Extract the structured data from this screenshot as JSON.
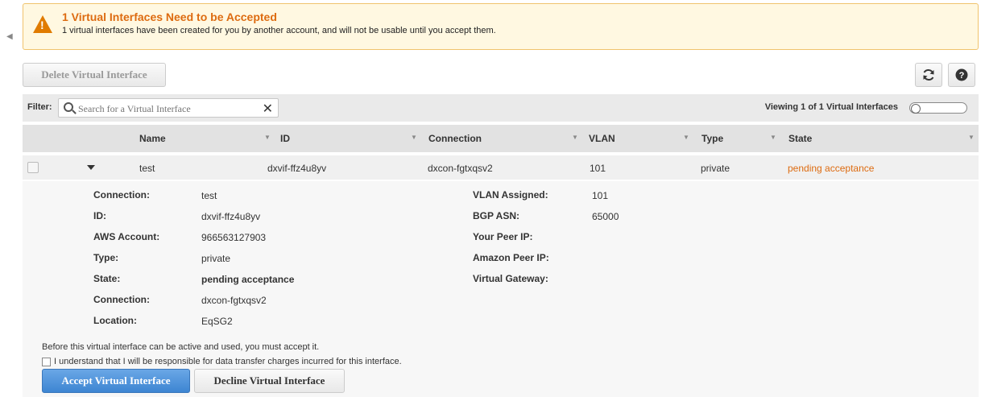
{
  "alert": {
    "title": "1 Virtual Interfaces Need to be Accepted",
    "message": "1 virtual interfaces have been created for you by another account, and will not be usable until you accept them."
  },
  "toolbar": {
    "delete_label": "Delete Virtual Interface"
  },
  "filter": {
    "label": "Filter:",
    "search_placeholder": "Search for a Virtual Interface",
    "search_value": "",
    "viewing_text": "Viewing 1 of 1 Virtual Interfaces"
  },
  "table": {
    "columns": [
      "Name",
      "ID",
      "Connection",
      "VLAN",
      "Type",
      "State"
    ],
    "rows": [
      {
        "name": "test",
        "id": "dxvif-ffz4u8yv",
        "connection": "dxcon-fgtxqsv2",
        "vlan": "101",
        "type": "private",
        "state": "pending acceptance"
      }
    ]
  },
  "detail": {
    "left": [
      {
        "label": "Connection:",
        "value": "test"
      },
      {
        "label": "ID:",
        "value": "dxvif-ffz4u8yv"
      },
      {
        "label": "AWS Account:",
        "value": "966563127903"
      },
      {
        "label": "Type:",
        "value": "private"
      },
      {
        "label": "State:",
        "value": "pending acceptance"
      },
      {
        "label": "Connection:",
        "value": "dxcon-fgtxqsv2"
      },
      {
        "label": "Location:",
        "value": "EqSG2"
      }
    ],
    "right": [
      {
        "label": "VLAN Assigned:",
        "value": "101"
      },
      {
        "label": "BGP ASN:",
        "value": "65000"
      },
      {
        "label": "Your Peer IP:",
        "value": ""
      },
      {
        "label": "Amazon Peer IP:",
        "value": ""
      },
      {
        "label": "Virtual Gateway:",
        "value": ""
      }
    ],
    "note": "Before this virtual interface can be active and used, you must accept it.",
    "agree_text": "I understand that I will be responsible for data transfer charges incurred for this interface.",
    "accept_label": "Accept Virtual Interface",
    "decline_label": "Decline Virtual Interface"
  },
  "colors": {
    "accent_orange": "#dd6b10",
    "primary_blue": "#3d85d2",
    "alert_bg": "#fff8e1"
  }
}
